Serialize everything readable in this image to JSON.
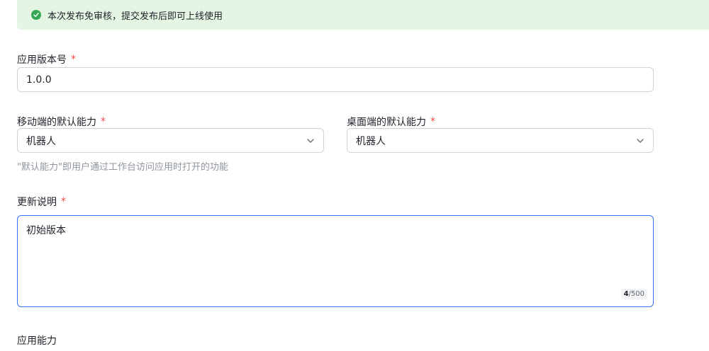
{
  "notice": {
    "text": "本次发布免审核，提交发布后即可上线使用"
  },
  "version": {
    "label": "应用版本号",
    "required": "*",
    "value": "1.0.0"
  },
  "mobile": {
    "label": "移动端的默认能力",
    "required": "*",
    "value": "机器人"
  },
  "desktop": {
    "label": "桌面端的默认能力",
    "required": "*",
    "value": "机器人"
  },
  "ability_hint": "\"默认能力\"即用户通过工作台访问应用时打开的功能",
  "update": {
    "label": "更新说明",
    "required": "*",
    "value": "初始版本",
    "count": "4",
    "max": "/500"
  },
  "capabilities": {
    "label": "应用能力"
  },
  "colors": {
    "accent": "#3370ff",
    "success": "#34a853",
    "required": "#f54a45",
    "notice_bg": "#e4f5e3"
  }
}
